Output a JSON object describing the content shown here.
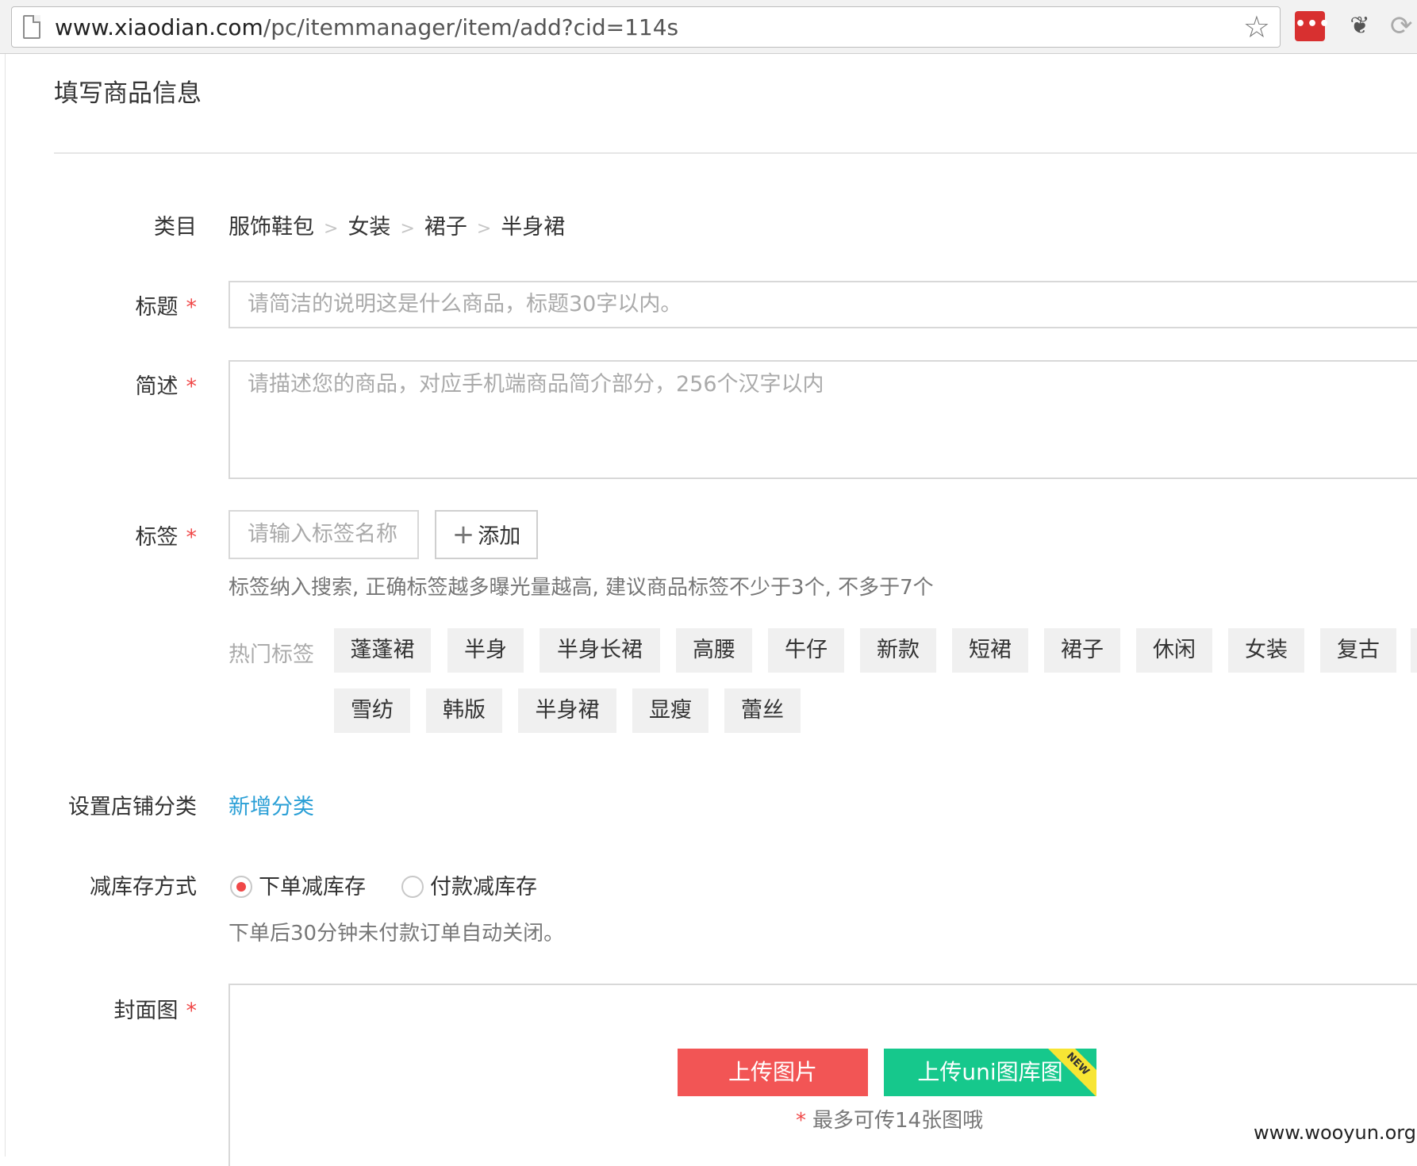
{
  "browser": {
    "url_host": "www.xiaodian.com",
    "url_path": "/pc/itemmanager/item/add?cid=114s",
    "ext_dots_label": "•••"
  },
  "page": {
    "title": "填写商品信息"
  },
  "category": {
    "label": "类目",
    "path": [
      "服饰鞋包",
      "女装",
      "裙子",
      "半身裙"
    ],
    "separator": ">"
  },
  "title_field": {
    "label": "标题",
    "required_mark": "*",
    "placeholder": "请简洁的说明这是什么商品，标题30字以内。"
  },
  "desc_field": {
    "label": "简述",
    "required_mark": "*",
    "placeholder": "请描述您的商品，对应手机端商品简介部分，256个汉字以内"
  },
  "tags": {
    "label": "标签",
    "required_mark": "*",
    "input_placeholder": "请输入标签名称",
    "add_label": "添加",
    "hint": "标签纳入搜索, 正确标签越多曝光量越高, 建议商品标签不少于3个, 不多于7个",
    "hot_label": "热门标签",
    "hot_tags_row1": [
      "蓬蓬裙",
      "半身",
      "半身长裙",
      "高腰",
      "牛仔",
      "新款",
      "短裙",
      "裙子",
      "休闲",
      "女装",
      "复古"
    ],
    "hot_tags_row2": [
      "雪纺",
      "韩版",
      "半身裙",
      "显瘦",
      "蕾丝"
    ]
  },
  "shop_category": {
    "label": "设置店铺分类",
    "link": "新增分类"
  },
  "stock": {
    "label": "减库存方式",
    "options": [
      "下单减库存",
      "付款减库存"
    ],
    "selected": "下单减库存",
    "hint": "下单后30分钟未付款订单自动关闭。"
  },
  "cover": {
    "label": "封面图",
    "required_mark": "*",
    "upload_label": "上传图片",
    "uni_label": "上传uni图库图",
    "new_badge": "NEW",
    "max_hint": "最多可传14张图哦",
    "max_mark": "*"
  },
  "watermark": "www.wooyun.org",
  "colors": {
    "accent_red": "#f25555",
    "accent_green": "#16c88c",
    "link_blue": "#2a9fd6",
    "required_red": "#f04848"
  }
}
